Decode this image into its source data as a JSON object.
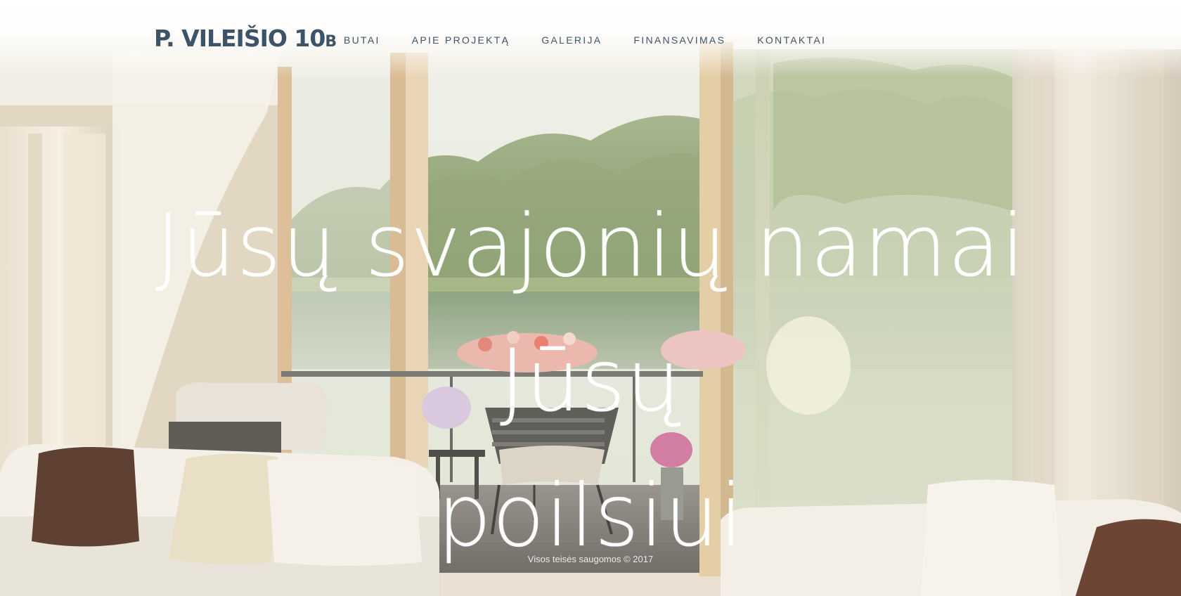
{
  "header": {
    "logo_main": "P. VILEIŠIO 10",
    "logo_suffix": "B",
    "nav": [
      {
        "label": "BUTAI"
      },
      {
        "label": "APIE PROJEKTĄ"
      },
      {
        "label": "GALERIJA"
      },
      {
        "label": "FINANSAVIMAS"
      },
      {
        "label": "KONTAKTAI"
      }
    ]
  },
  "hero": {
    "line1": "Jūsų svajonių namai Jūsų",
    "line2": "poilsiui"
  },
  "footer": {
    "copyright": "Visos teisės saugomos © 2017"
  },
  "colors": {
    "brand": "#3d5468",
    "hero_text": "#ffffff"
  }
}
